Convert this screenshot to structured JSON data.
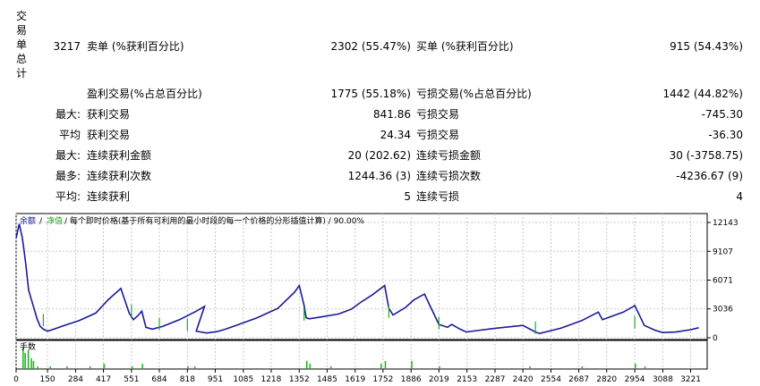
{
  "section_label": [
    "交",
    "易",
    "单",
    "总",
    "计"
  ],
  "rows": [
    {
      "top": 42,
      "count": "3217",
      "label1": "卖单 (%获利百分比)",
      "value1": "2302 (55.47%)",
      "label2": "买单 (%获利百分比)",
      "value2": "915 (54.43%)"
    },
    {
      "top": 95,
      "count": "",
      "label1": "盈利交易(%占总百分比)",
      "value1": "1775 (55.18%)",
      "label2": "亏损交易(%占总百分比)",
      "value2": "1442 (44.82%)"
    },
    {
      "top": 118,
      "count": "最大:",
      "label1": "获利交易",
      "value1": "841.86",
      "label2": "亏损交易",
      "value2": "-745.30"
    },
    {
      "top": 141,
      "count": "平均",
      "label1": "获利交易",
      "value1": "24.34",
      "label2": "亏损交易",
      "value2": "-36.30"
    },
    {
      "top": 164,
      "count": "最大:",
      "label1": "连续获利金额",
      "value1": "20 (202.62)",
      "label2": "连续亏损金额",
      "value2": "30 (-3758.75)"
    },
    {
      "top": 187,
      "count": "最多:",
      "label1": "连续获利次数",
      "value1": "1244.36 (3)",
      "label2": "连续亏损次数",
      "value2": "-4236.67 (9)"
    },
    {
      "top": 210,
      "count": "平均:",
      "label1": "连续获利",
      "value1": "5",
      "label2": "连续亏损",
      "value2": "4"
    }
  ],
  "chart": {
    "legend_balance": "余额",
    "legend_equity": "净值",
    "legend_rest": "/ 每个即时价格(基于所有可利用的最小时段的每一个价格的分形插值计算) / 90.00%",
    "volume_label": "手数",
    "colors": {
      "balance": "#1a1a9a",
      "equity": "#19b219",
      "axis": "#000000",
      "grid": "#c8c8c8"
    }
  },
  "chart_data": {
    "type": "line",
    "y_ticks": [
      "12143",
      "9107",
      "6071",
      "3036",
      "0"
    ],
    "x_ticks": [
      "0",
      "150",
      "284",
      "417",
      "551",
      "684",
      "818",
      "951",
      "1085",
      "1218",
      "1352",
      "1485",
      "1619",
      "1752",
      "1886",
      "2019",
      "2153",
      "2287",
      "2420",
      "2554",
      "2687",
      "2820",
      "2954",
      "3088",
      "3221"
    ],
    "ylim": [
      0,
      12143
    ],
    "xlim": [
      0,
      3300
    ],
    "series": [
      {
        "name": "余额",
        "x": [
          0,
          15,
          30,
          45,
          60,
          80,
          100,
          115,
          130,
          150,
          180,
          230,
          300,
          380,
          440,
          470,
          500,
          540,
          560,
          580,
          600,
          620,
          650,
          700,
          780,
          860,
          900,
          860,
          910,
          960,
          1000,
          1050,
          1150,
          1250,
          1330,
          1352,
          1375,
          1385,
          1400,
          1460,
          1540,
          1600,
          1650,
          1700,
          1760,
          1780,
          1800,
          1860,
          1900,
          1950,
          1980,
          2019,
          2060,
          2080,
          2120,
          2150,
          2200,
          2287,
          2420,
          2480,
          2500,
          2600,
          2700,
          2780,
          2800,
          2900,
          2940,
          2954,
          3000,
          3050,
          3088,
          3150,
          3221,
          3260
        ],
        "y": [
          10500,
          12000,
          10500,
          8000,
          5000,
          3500,
          2000,
          1200,
          900,
          700,
          900,
          1300,
          1800,
          2600,
          4000,
          4600,
          5200,
          2600,
          1900,
          2300,
          2800,
          1100,
          900,
          1200,
          1900,
          2800,
          3300,
          700,
          500,
          650,
          900,
          1300,
          2100,
          3100,
          4800,
          5500,
          3400,
          2100,
          2000,
          2200,
          2500,
          3000,
          3800,
          4500,
          5500,
          3100,
          2400,
          3200,
          4000,
          4600,
          3200,
          1400,
          1100,
          1400,
          900,
          600,
          750,
          1000,
          1300,
          600,
          450,
          1000,
          1800,
          2700,
          1900,
          2700,
          3200,
          3400,
          1300,
          800,
          550,
          600,
          850,
          1050
        ]
      },
      {
        "name": "净值",
        "x": [
          130,
          551,
          684,
          818,
          1375,
          1780,
          2019,
          2480,
          2954
        ],
        "y": [
          1200,
          2200,
          800,
          700,
          1800,
          2100,
          900,
          400,
          1000
        ]
      }
    ],
    "volume": {
      "x": [
        30,
        40,
        55,
        70,
        80,
        100,
        160,
        240,
        350,
        417,
        551,
        600,
        818,
        850,
        1385,
        1400,
        1500,
        1740,
        1760,
        1886,
        2019,
        2450,
        2700,
        2954,
        3000
      ],
      "y": [
        8,
        6,
        7,
        4,
        3,
        1,
        1,
        1,
        1,
        2,
        1,
        2,
        1,
        1,
        3,
        2,
        1,
        2,
        3,
        3,
        1,
        1,
        1,
        2,
        1
      ]
    }
  }
}
